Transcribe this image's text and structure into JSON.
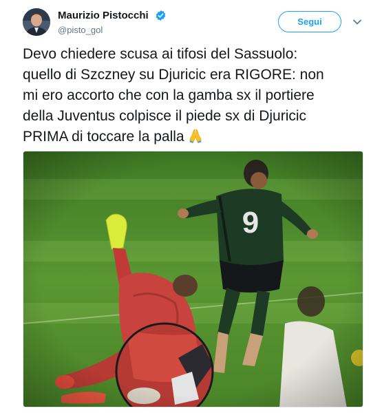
{
  "author": {
    "name": "Maurizio Pistocchi",
    "handle": "@pisto_gol",
    "verified": true
  },
  "actions": {
    "follow_label": "Segui",
    "menu_icon": "chevron-down-icon"
  },
  "tweet": {
    "lines": [
      "Devo chiedere scusa ai tifosi del Sassuolo:",
      "quello di Szczney su Djuricic era RIGORE: non",
      "mi ero accorto che con la gamba sx il portiere",
      "della Juventus colpisce il piede sx di Djuricic",
      "PRIMA di toccare la palla"
    ],
    "emoji_icon": "folded-hands-icon"
  },
  "media": {
    "jersey_number": "9"
  },
  "colors": {
    "accent": "#1da1f2",
    "text": "#14171a",
    "secondary": "#657786",
    "pitch": "#4f8a2a"
  }
}
